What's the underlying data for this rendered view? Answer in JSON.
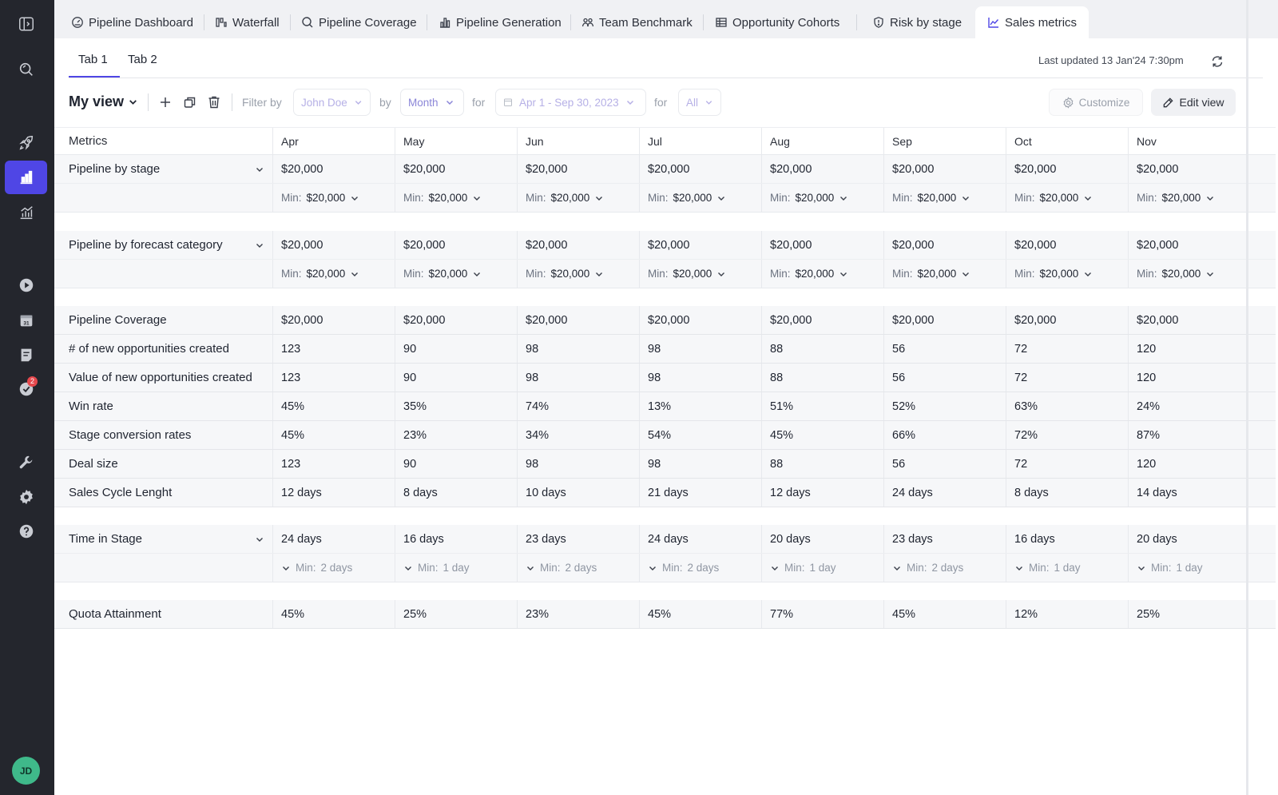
{
  "top_tabs": [
    {
      "label": "Pipeline Dashboard",
      "icon": "speedometer-icon"
    },
    {
      "label": "Waterfall",
      "icon": "waterfall-icon"
    },
    {
      "label": "Pipeline Coverage",
      "icon": "search-icon"
    },
    {
      "label": "Pipeline Generation",
      "icon": "bar-chart-icon"
    },
    {
      "label": "Team Benchmark",
      "icon": "team-icon"
    },
    {
      "label": "Opportunity Cohorts",
      "icon": "table-icon"
    },
    {
      "label": "Risk by stage",
      "icon": "shield-icon"
    },
    {
      "label": "Sales metrics",
      "icon": "line-chart-icon",
      "active": true
    }
  ],
  "sub_tabs": [
    "Tab 1",
    "Tab 2"
  ],
  "last_updated": "Last updated 13 Jan'24 7:30pm",
  "toolbar": {
    "view_name": "My view",
    "filter_by_label": "Filter by",
    "filter_value": "John Doe",
    "by_label": "by",
    "period_value": "Month",
    "for_label_1": "for",
    "date_range": "Apr 1 - Sep 30, 2023",
    "for_label_2": "for",
    "scope_value": "All",
    "customize_label": "Customize",
    "edit_view_label": "Edit view"
  },
  "table": {
    "metrics_header": "Metrics",
    "columns": [
      "Apr",
      "May",
      "Jun",
      "Jul",
      "Aug",
      "Sep",
      "Oct",
      "Nov"
    ],
    "min_label": "Min:",
    "rows": {
      "pipeline_by_stage": {
        "label": "Pipeline by stage",
        "values": [
          "$20,000",
          "$20,000",
          "$20,000",
          "$20,000",
          "$20,000",
          "$20,000",
          "$20,000",
          "$20,000"
        ],
        "mins": [
          "$20,000",
          "$20,000",
          "$20,000",
          "$20,000",
          "$20,000",
          "$20,000",
          "$20,000",
          "$20,000"
        ]
      },
      "pipeline_by_forecast": {
        "label": "Pipeline by forecast category",
        "values": [
          "$20,000",
          "$20,000",
          "$20,000",
          "$20,000",
          "$20,000",
          "$20,000",
          "$20,000",
          "$20,000"
        ],
        "mins": [
          "$20,000",
          "$20,000",
          "$20,000",
          "$20,000",
          "$20,000",
          "$20,000",
          "$20,000",
          "$20,000"
        ]
      },
      "pipeline_coverage": {
        "label": "Pipeline Coverage",
        "values": [
          "$20,000",
          "$20,000",
          "$20,000",
          "$20,000",
          "$20,000",
          "$20,000",
          "$20,000",
          "$20,000"
        ]
      },
      "new_opps_count": {
        "label": "# of new opportunities created",
        "values": [
          "123",
          "90",
          "98",
          "98",
          "88",
          "56",
          "72",
          "120"
        ]
      },
      "new_opps_value": {
        "label": "Value of new opportunities created",
        "values": [
          "123",
          "90",
          "98",
          "98",
          "88",
          "56",
          "72",
          "120"
        ]
      },
      "win_rate": {
        "label": "Win rate",
        "values": [
          "45%",
          "35%",
          "74%",
          "13%",
          "51%",
          "52%",
          "63%",
          "24%"
        ]
      },
      "stage_conversion": {
        "label": "Stage conversion rates",
        "values": [
          "45%",
          "23%",
          "34%",
          "54%",
          "45%",
          "66%",
          "72%",
          "87%"
        ]
      },
      "deal_size": {
        "label": "Deal size",
        "values": [
          "123",
          "90",
          "98",
          "98",
          "88",
          "56",
          "72",
          "120"
        ]
      },
      "sales_cycle": {
        "label": "Sales Cycle Lenght",
        "values": [
          "12 days",
          "8 days",
          "10 days",
          "21 days",
          "12 days",
          "24 days",
          "8 days",
          "14 days"
        ]
      },
      "time_in_stage": {
        "label": "Time in Stage",
        "values": [
          "24 days",
          "16 days",
          "23 days",
          "24 days",
          "20 days",
          "23 days",
          "16 days",
          "20 days"
        ],
        "mins": [
          "2 days",
          "1 day",
          "2 days",
          "2 days",
          "1 day",
          "2 days",
          "1 day",
          "1 day"
        ]
      },
      "quota_attainment": {
        "label": "Quota Attainment",
        "values": [
          "45%",
          "25%",
          "23%",
          "45%",
          "77%",
          "45%",
          "12%",
          "25%"
        ]
      }
    }
  },
  "sidebar": {
    "icons": [
      "sidebar-toggle-icon",
      "search-icon",
      "rocket-icon",
      "bar-chart-icon",
      "analytics-icon",
      "play-icon",
      "calendar-icon",
      "notes-icon",
      "tasks-icon",
      "wrench-icon",
      "gear-icon",
      "help-icon"
    ],
    "calendar_day": "31",
    "tasks_badge": "2",
    "avatar_initials": "JD"
  },
  "colors": {
    "accent": "#4f46e5",
    "rail_bg": "#24262d",
    "badge": "#e5484d",
    "avatar": "#3fb98a"
  }
}
